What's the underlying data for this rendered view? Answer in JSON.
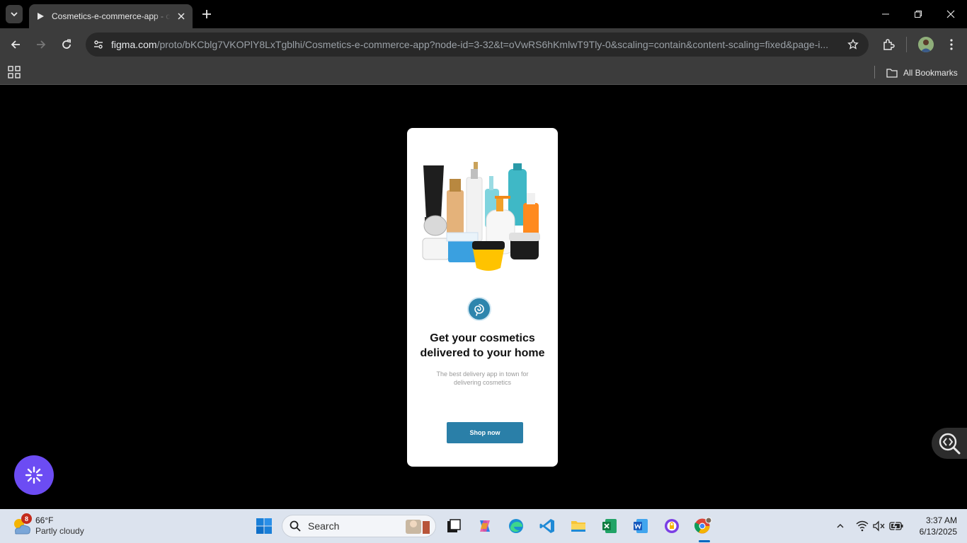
{
  "browser": {
    "tab_title": "Cosmetics-e-commerce-app - c",
    "url_host": "figma.com",
    "url_path": "/proto/bKCblg7VKOPlY8LxTgblhi/Cosmetics-e-commerce-app?node-id=3-32&t=oVwRS6hKmlwT9Tly-0&scaling=contain&content-scaling=fixed&page-i...",
    "bookmarks_label": "All Bookmarks"
  },
  "app": {
    "headline": "Get your cosmetics delivered to your home",
    "subtitle": "The best delivery app in town for delivering cosmetics",
    "cta_label": "Shop now"
  },
  "taskbar": {
    "weather_temp": "66°F",
    "weather_condition": "Partly cloudy",
    "weather_badge": "8",
    "search_label": "Search",
    "time": "3:37 AM",
    "date": "6/13/2025"
  },
  "colors": {
    "accent": "#2a7fa8",
    "fab": "#6c4cf3"
  }
}
